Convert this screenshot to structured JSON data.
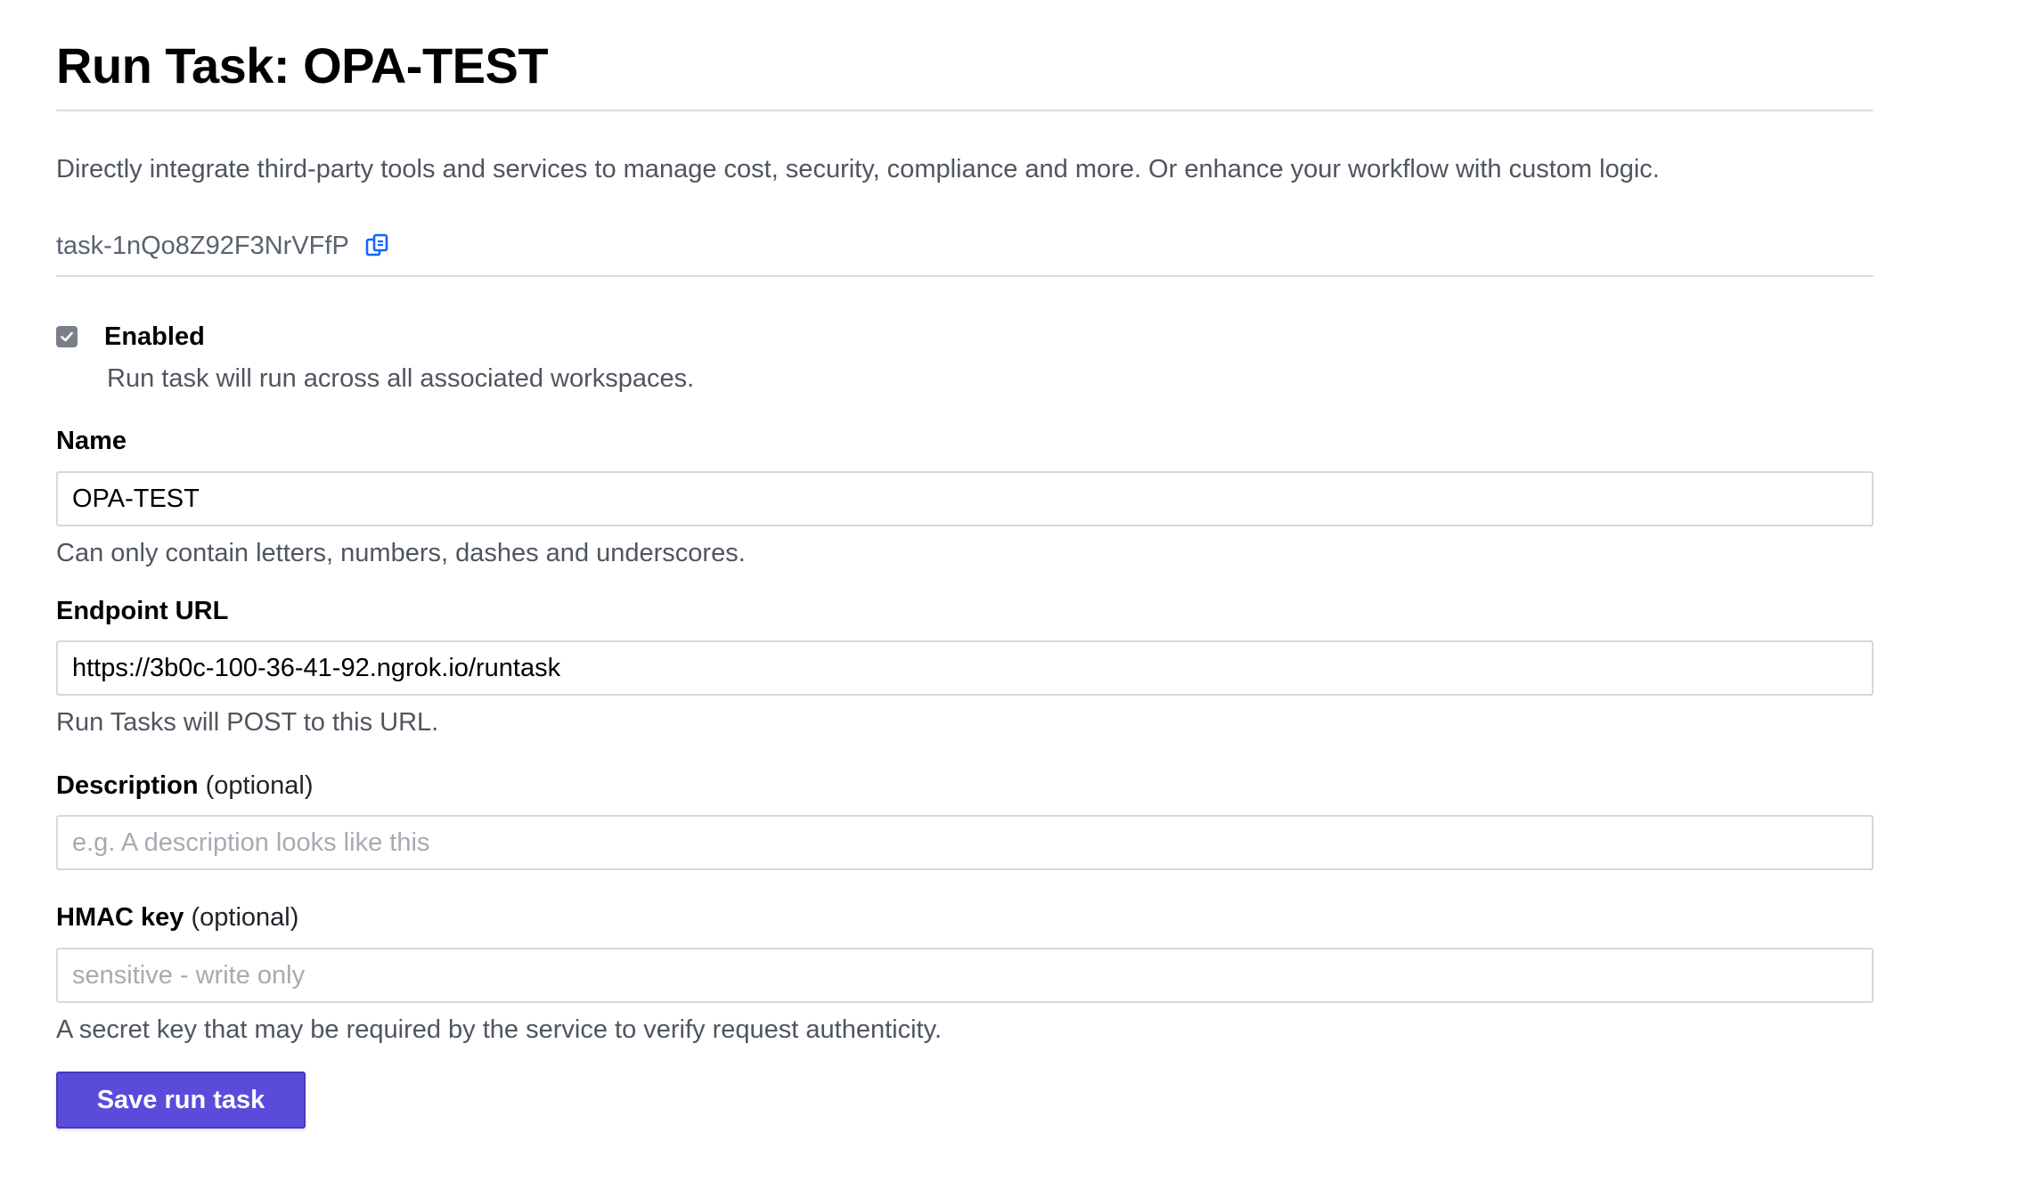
{
  "header": {
    "title": "Run Task: OPA-TEST",
    "intro": "Directly integrate third-party tools and services to manage cost, security, compliance and more. Or enhance your workflow with custom logic."
  },
  "task": {
    "id": "task-1nQo8Z92F3NrVFfP",
    "copy_icon": "copy-icon"
  },
  "enabled": {
    "label": "Enabled",
    "checked": true,
    "help": "Run task will run across all associated workspaces."
  },
  "form": {
    "name": {
      "label": "Name",
      "value": "OPA-TEST",
      "help": "Can only contain letters, numbers, dashes and underscores."
    },
    "endpoint": {
      "label": "Endpoint URL",
      "value": "https://3b0c-100-36-41-92.ngrok.io/runtask",
      "help": "Run Tasks will POST to this URL."
    },
    "description": {
      "label": "Description",
      "optional": "(optional)",
      "value": "",
      "placeholder": "e.g. A description looks like this"
    },
    "hmac": {
      "label": "HMAC key",
      "optional": "(optional)",
      "value": "",
      "placeholder": "sensitive - write only",
      "help": "A secret key that may be required by the service to verify request authenticity."
    },
    "submit_label": "Save run task"
  },
  "colors": {
    "primary": "#5b4bdb",
    "copy_icon": "#1563ff",
    "divider": "#dcdee2"
  }
}
